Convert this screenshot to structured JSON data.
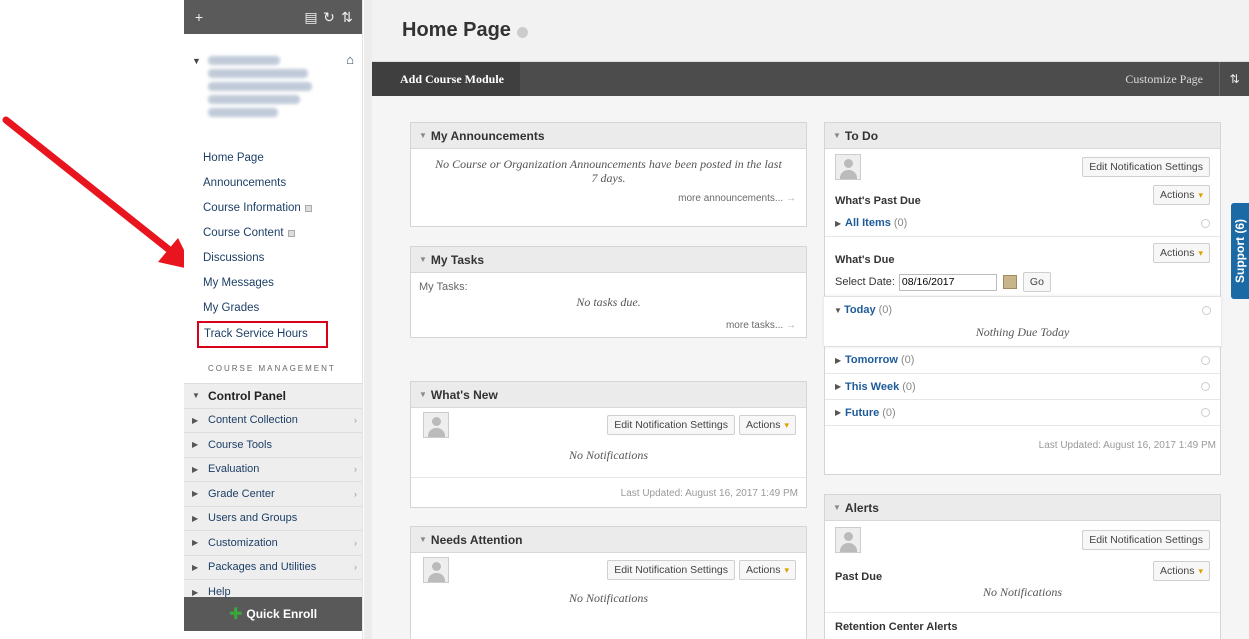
{
  "sidebar": {
    "nav": [
      {
        "label": "Home Page",
        "box": false
      },
      {
        "label": "Announcements",
        "box": false
      },
      {
        "label": "Course Information",
        "box": true
      },
      {
        "label": "Course Content",
        "box": true
      },
      {
        "label": "Discussions",
        "box": false
      },
      {
        "label": "My Messages",
        "box": false
      },
      {
        "label": "My Grades",
        "box": false
      },
      {
        "label": "Track Service Hours",
        "box": false
      }
    ],
    "course_management": "COURSE MANAGEMENT",
    "control_panel": "Control Panel",
    "cp_items": [
      {
        "label": "Content Collection",
        "chevron": true
      },
      {
        "label": "Course Tools",
        "chevron": false
      },
      {
        "label": "Evaluation",
        "chevron": true
      },
      {
        "label": "Grade Center",
        "chevron": true
      },
      {
        "label": "Users and Groups",
        "chevron": false
      },
      {
        "label": "Customization",
        "chevron": true
      },
      {
        "label": "Packages and Utilities",
        "chevron": true
      },
      {
        "label": "Help",
        "chevron": false
      }
    ],
    "quick_enroll": "Quick Enroll"
  },
  "main": {
    "title": "Home Page",
    "add_module": "Add Course Module",
    "customize": "Customize Page"
  },
  "announcements": {
    "title": "My Announcements",
    "message": "No Course or Organization Announcements have been posted in the last 7 days.",
    "more": "more announcements..."
  },
  "tasks": {
    "title": "My Tasks",
    "label": "My Tasks:",
    "message": "No tasks due.",
    "more": "more tasks..."
  },
  "whats_new": {
    "title": "What's New",
    "edit": "Edit Notification Settings",
    "actions": "Actions",
    "message": "No Notifications",
    "updated": "Last Updated: August 16, 2017 1:49 PM"
  },
  "needs_attention": {
    "title": "Needs Attention",
    "edit": "Edit Notification Settings",
    "actions": "Actions",
    "message": "No Notifications"
  },
  "todo": {
    "title": "To Do",
    "edit": "Edit Notification Settings",
    "actions": "Actions",
    "past_due": "What's Past Due",
    "all_items": "All Items",
    "all_items_count": "(0)",
    "whats_due": "What's Due",
    "select_date": "Select Date:",
    "date_value": "08/16/2017",
    "go": "Go",
    "today": "Today",
    "today_count": "(0)",
    "nothing_due": "Nothing Due Today",
    "tomorrow": "Tomorrow",
    "tomorrow_count": "(0)",
    "this_week": "This Week",
    "this_week_count": "(0)",
    "future": "Future",
    "future_count": "(0)",
    "updated": "Last Updated: August 16, 2017 1:49 PM"
  },
  "alerts": {
    "title": "Alerts",
    "edit": "Edit Notification Settings",
    "actions": "Actions",
    "past_due": "Past Due",
    "message": "No Notifications",
    "retention": "Retention Center Alerts"
  },
  "support": "Support (6)"
}
